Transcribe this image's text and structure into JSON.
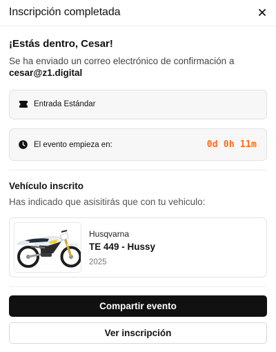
{
  "header": {
    "title": "Inscripción completada",
    "close_icon": "close-icon"
  },
  "confirmation": {
    "greeting": "¡Estás dentro, Cesar!",
    "message": "Se ha enviado un correo electrónico de confirmación a",
    "email": "cesar@z1.digital"
  },
  "ticket": {
    "icon": "ticket-icon",
    "label": "Entrada Estándar"
  },
  "event_timer": {
    "icon": "clock-icon",
    "label": "El evento empieza en:",
    "countdown": "0d 0h 11m",
    "countdown_color": "#ff6a13"
  },
  "vehicle_section": {
    "title": "Vehículo inscrito",
    "subtitle": "Has indicado que asisitirás que con tu vehiculo:"
  },
  "vehicle": {
    "brand": "Husqvarna",
    "model": "TE 449 - Hussy",
    "year": "2025",
    "image": "dirt-bike-image"
  },
  "actions": {
    "share_label": "Compartir evento",
    "view_label": "Ver inscripción"
  }
}
